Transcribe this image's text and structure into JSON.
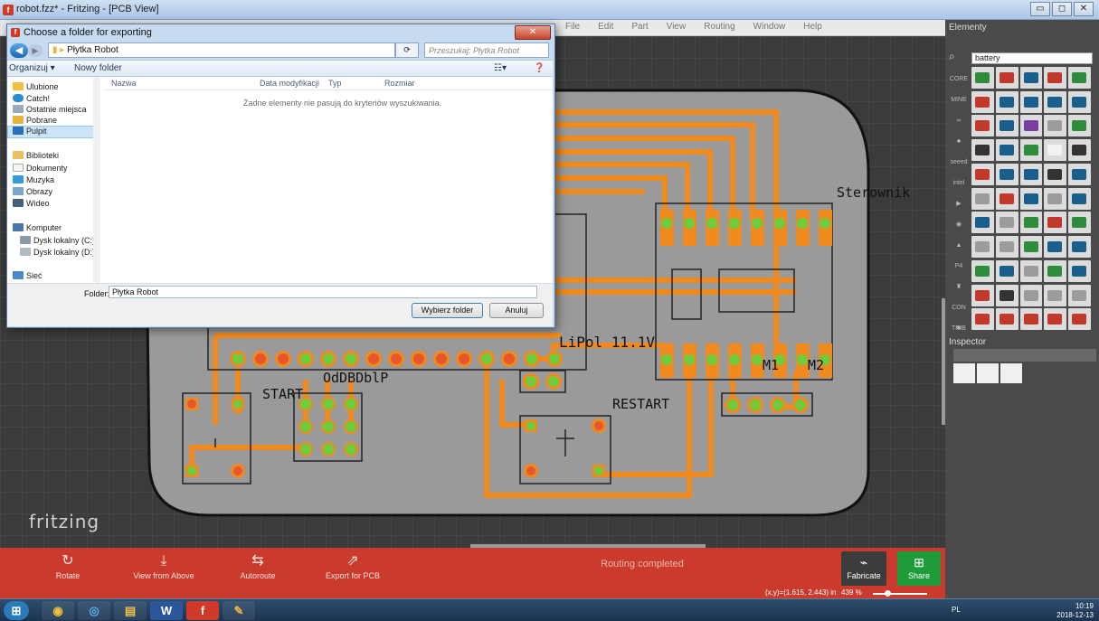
{
  "window": {
    "title": "robot.fzz* - Fritzing - [PCB View]",
    "app_icon": "f",
    "min": "▭",
    "max": "◻",
    "close": "✕"
  },
  "menubar": [
    "File",
    "Edit",
    "Part",
    "View",
    "Routing",
    "Window",
    "Help"
  ],
  "canvas": {
    "logo": "fritzing",
    "labels": {
      "sterownik": "Sterownik",
      "lipol": "LiPol 11.1V",
      "odbdbd": "OdDBDblP",
      "start": "START",
      "restart": "RESTART",
      "m1": "M1",
      "m2": "M2"
    }
  },
  "toolbar": {
    "rotate": "Rotate",
    "view_from_above": "View from Above",
    "autoroute": "Autoroute",
    "export": "Export for PCB",
    "routing_status": "Routing completed",
    "fabricate": "Fabricate",
    "share": "Share"
  },
  "statusbar": {
    "coords": "(x,y)=(1.615, 2.443) in",
    "zoom": "439 %"
  },
  "parts_panel": {
    "title": "Elementy",
    "search_value": "battery",
    "tabs": [
      "CORE",
      "MINE",
      "∞",
      "♣",
      "seeed",
      "intel",
      "▶",
      "◉",
      "▲",
      "P4",
      "♜",
      "CON TRIB",
      "✱",
      "▦"
    ],
    "colors": [
      "#2e8b3a",
      "#c0392b",
      "#1a5f8c",
      "#c0392b",
      "#2e8b3a",
      "#c0392b",
      "#1a5f8c",
      "#1a5f8c",
      "#1a5f8c",
      "#1a5f8c",
      "#c0392b",
      "#1a5f8c",
      "#7a3fa0",
      "#9c9c9c",
      "#2e8b3a",
      "#333333",
      "#1a5f8c",
      "#2e8b3a",
      "#f2f2f2",
      "#333333",
      "#c0392b",
      "#1a5f8c",
      "#1a5f8c",
      "#333333",
      "#1a5f8c",
      "#9c9c9c",
      "#c0392b",
      "#1a5f8c",
      "#9c9c9c",
      "#1a5f8c",
      "#1a5f8c",
      "#9c9c9c",
      "#2e8b3a",
      "#c0392b",
      "#2e8b3a",
      "#9c9c9c",
      "#9c9c9c",
      "#2e8b3a",
      "#1a5f8c",
      "#1a5f8c",
      "#2e8b3a",
      "#1a5f8c",
      "#9c9c9c",
      "#2e8b3a",
      "#1a5f8c",
      "#c0392b",
      "#333333",
      "#9c9c9c",
      "#9c9c9c",
      "#9c9c9c",
      "#c0392b",
      "#c0392b",
      "#c0392b",
      "#c0392b",
      "#c0392b"
    ]
  },
  "inspector": {
    "title": "Inspector"
  },
  "taskbar": {
    "apps": [
      "⊞",
      "◉",
      "◎",
      "▤",
      "W",
      "f",
      "✎"
    ],
    "lang": "PL",
    "time": "10:19",
    "date": "2018-12-13"
  },
  "dialog": {
    "title": "Choose a folder for exporting",
    "close": "✕",
    "address": "Płytka Robot",
    "search_placeholder": "Przeszukaj: Płytka Robot",
    "organize": "Organizuj ▾",
    "new_folder": "Nowy folder",
    "nav": {
      "favorites": "Ulubione",
      "catch": "Catch!",
      "recent": "Ostatnie miejsca",
      "downloads": "Pobrane",
      "desktop": "Pulpit",
      "libraries": "Biblioteki",
      "documents": "Dokumenty",
      "music": "Muzyka",
      "pictures": "Obrazy",
      "video": "Wideo",
      "computer": "Komputer",
      "disk_c": "Dysk lokalny (C:)",
      "disk_d": "Dysk lokalny (D:)",
      "network": "Sieć"
    },
    "columns": {
      "name": "Nazwa",
      "date": "Data modyfikacji",
      "type": "Typ",
      "size": "Rozmiar"
    },
    "empty": "Żadne elementy nie pasują do kryteriów wyszukiwania.",
    "folder_label": "Folder:",
    "folder_value": "Płytka Robot",
    "ok": "Wybierz folder",
    "cancel": "Anuluj"
  }
}
